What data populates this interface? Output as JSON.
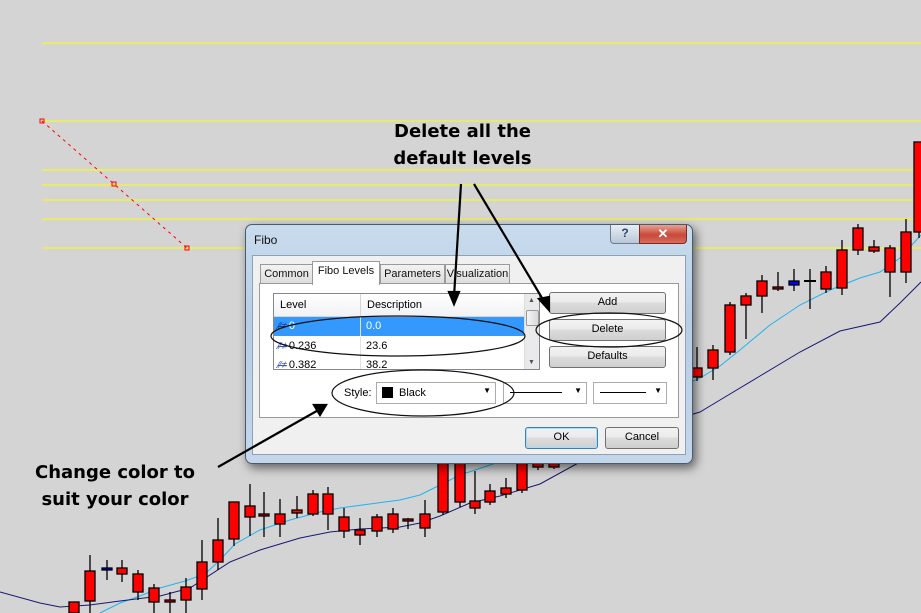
{
  "annotations": {
    "top_line1": "Delete all the",
    "top_line2": "default levels",
    "bottom_line1": "Change color to",
    "bottom_line2": "suit your color"
  },
  "dialog": {
    "title": "Fibo",
    "help_label": "?",
    "close_label": "✕",
    "tabs": [
      {
        "label": "Common",
        "active": false
      },
      {
        "label": "Fibo Levels",
        "active": true
      },
      {
        "label": "Parameters",
        "active": false
      },
      {
        "label": "Visualization",
        "active": false
      }
    ],
    "levels_list": {
      "headers": {
        "level": "Level",
        "description": "Description"
      },
      "rows": [
        {
          "level": "0",
          "description": "0.0",
          "selected": true
        },
        {
          "level": "0.236",
          "description": "23.6",
          "selected": false
        },
        {
          "level": "0.382",
          "description": "38.2",
          "selected": false
        }
      ],
      "icon": "level-line-icon"
    },
    "buttons": {
      "add": "Add",
      "delete": "Delete",
      "defaults": "Defaults",
      "ok": "OK",
      "cancel": "Cancel"
    },
    "style": {
      "label": "Style:",
      "color_value": "Black",
      "color_swatch": "#000000",
      "line_style": "solid",
      "line_width": "thin"
    }
  },
  "chart": {
    "colors": {
      "background": "#d4d4d4",
      "fibo_levels": "#ffff00",
      "fibo_trendline": "#ff0000",
      "bull_candle": "#0000ff",
      "bear_candle": "#ff0000",
      "ma_fast": "#1fb4ef",
      "ma_slow": "#191970",
      "annotation_ink": "#000000"
    }
  }
}
